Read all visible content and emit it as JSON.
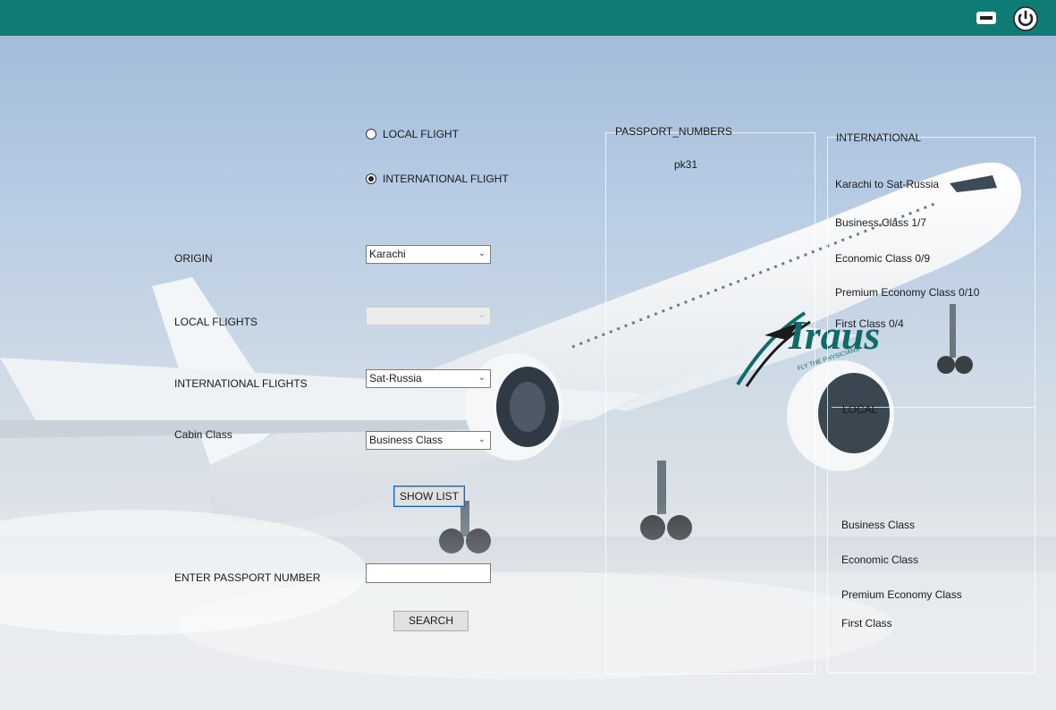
{
  "radios": {
    "local": {
      "label": "LOCAL FLIGHT",
      "checked": false
    },
    "international": {
      "label": "INTERNATIONAL FLIGHT",
      "checked": true
    }
  },
  "form": {
    "origin_label": "ORIGIN",
    "origin_value": "Karachi",
    "local_flights_label": "LOCAL FLIGHTS",
    "local_flights_value": "",
    "international_flights_label": "INTERNATIONAL FLIGHTS",
    "international_flights_value": "Sat-Russia",
    "cabin_class_label": "Cabin Class",
    "cabin_class_value": "Business Class",
    "show_list_label": "SHOW LIST",
    "passport_label": "ENTER PASSPORT NUMBER",
    "passport_value": "",
    "search_label": "SEARCH"
  },
  "passport_panel": {
    "title": "PASSPORT_NUMBERS",
    "items": [
      "pk31"
    ]
  },
  "international_panel": {
    "title": "INTERNATIONAL",
    "route": "Karachi to Sat-Russia",
    "business": "Business Class 1/7",
    "economic": "Economic Class 0/9",
    "premium": "Premium Economy Class 0/10",
    "first": "First Class 0/4"
  },
  "local_panel": {
    "title": "LOCAL",
    "business": "Business Class",
    "economic": "Economic Class",
    "premium": "Premium Economy Class",
    "first": "First Class"
  },
  "logo_text": "Iraus",
  "logo_tagline": "FLY THE PHYSICIANS",
  "icons": {
    "minimize": "minimize-icon",
    "power": "power-icon"
  },
  "colors": {
    "titlebar": "#0e7b74",
    "logo": "#0e6b6a"
  }
}
